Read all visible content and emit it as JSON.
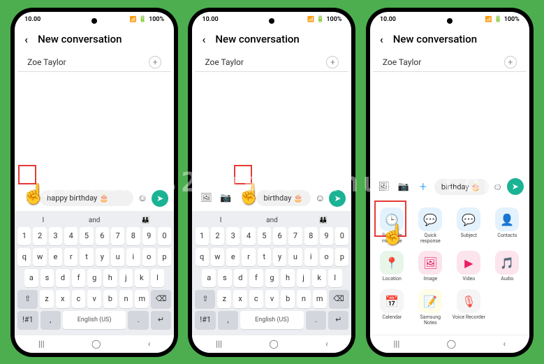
{
  "status": {
    "time": "10.00",
    "battery": "100%"
  },
  "header": {
    "title": "New conversation"
  },
  "recipient": {
    "name": "Zoe Taylor"
  },
  "compose": {
    "text_full": "happy birthday 🎂",
    "text_short": "birthday 🎂"
  },
  "suggestions": {
    "s1": "I",
    "s2": "and",
    "s3": "👪"
  },
  "keyboard": {
    "row1": [
      "1",
      "2",
      "3",
      "4",
      "5",
      "6",
      "7",
      "8",
      "9",
      "0"
    ],
    "row2": [
      "q",
      "w",
      "e",
      "r",
      "t",
      "y",
      "u",
      "i",
      "o",
      "p"
    ],
    "row3": [
      "a",
      "s",
      "d",
      "f",
      "g",
      "h",
      "j",
      "k",
      "l"
    ],
    "row4_shift": "⇧",
    "row4": [
      "z",
      "x",
      "c",
      "v",
      "b",
      "n",
      "m"
    ],
    "row4_del": "⌫",
    "row5_sym": "!#1",
    "row5_space": "English (US)",
    "row5_comma": ",",
    "row5_dot": "."
  },
  "attach": {
    "items": [
      {
        "label": "Schedule message",
        "bg": "ic-blue-bg",
        "glyph": "🕒",
        "color": "#2196f3"
      },
      {
        "label": "Quick response",
        "bg": "ic-blue-bg",
        "glyph": "💬",
        "color": "#2196f3"
      },
      {
        "label": "Subject",
        "bg": "ic-blue-bg",
        "glyph": "💬",
        "color": "#2196f3"
      },
      {
        "label": "Contacts",
        "bg": "ic-blue-bg",
        "glyph": "👤",
        "color": "#2196f3"
      },
      {
        "label": "Location",
        "bg": "ic-green-bg",
        "glyph": "📍",
        "color": "#4caf50"
      },
      {
        "label": "Image",
        "bg": "ic-pink-bg",
        "glyph": "🖼",
        "color": "#e91e63"
      },
      {
        "label": "Video",
        "bg": "ic-pink-bg",
        "glyph": "▶",
        "color": "#e91e63"
      },
      {
        "label": "Audio",
        "bg": "ic-pink-bg",
        "glyph": "🎵",
        "color": "#e91e63"
      },
      {
        "label": "Calendar",
        "bg": "ic-gray-bg",
        "glyph": "📅",
        "color": "#666"
      },
      {
        "label": "Samsung Notes",
        "bg": "ic-yellow-bg",
        "glyph": "📝",
        "color": "#f9a825"
      },
      {
        "label": "Voice Recorder",
        "bg": "ic-gray-bg",
        "glyph": "🎙",
        "color": "#f44336"
      }
    ]
  },
  "watermark": "galaxys23usermanual.com"
}
